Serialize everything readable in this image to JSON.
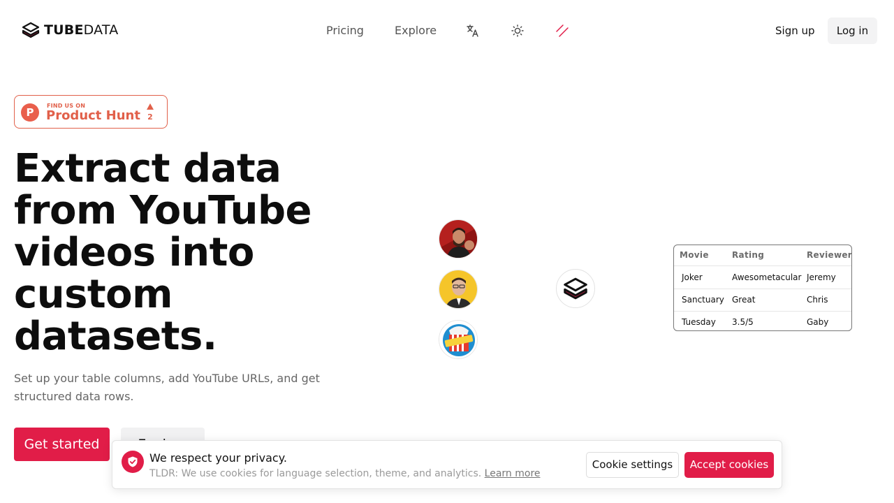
{
  "header": {
    "logo_bold": "TUBE",
    "logo_light": "DATA",
    "nav": {
      "pricing": "Pricing",
      "explore": "Explore"
    },
    "signup": "Sign up",
    "login": "Log in"
  },
  "product_hunt": {
    "small": "FIND US ON",
    "big": "Product Hunt",
    "letter": "P",
    "upvotes": "2"
  },
  "hero": {
    "title_lines": [
      "Extract data",
      "from YouTube",
      "videos into",
      "custom",
      "datasets."
    ],
    "subtitle": "Set up your table columns, add YouTube URLs, and get structured data rows.",
    "primary_button": "Get started",
    "secondary_button": "Explore"
  },
  "table": {
    "headers": [
      "Movie",
      "Rating",
      "Reviewer"
    ],
    "rows": [
      [
        "Joker",
        "Awesometacular",
        "Jeremy"
      ],
      [
        "Sanctuary",
        "Great",
        "Chris"
      ],
      [
        "Tuesday",
        "3.5/5",
        "Gaby"
      ]
    ]
  },
  "cookie": {
    "title": "We respect your privacy.",
    "text": "TLDR: We use cookies for language selection, theme, and analytics.",
    "link": "Learn more",
    "settings_button": "Cookie settings",
    "accept_button": "Accept cookies"
  },
  "colors": {
    "brand": "#e11d48",
    "product_hunt": "#e1604a",
    "muted_text": "#666666"
  },
  "icons": [
    "logo-stack-icon",
    "translate-icon",
    "sun-icon",
    "slash-icon",
    "shield-check-icon"
  ]
}
